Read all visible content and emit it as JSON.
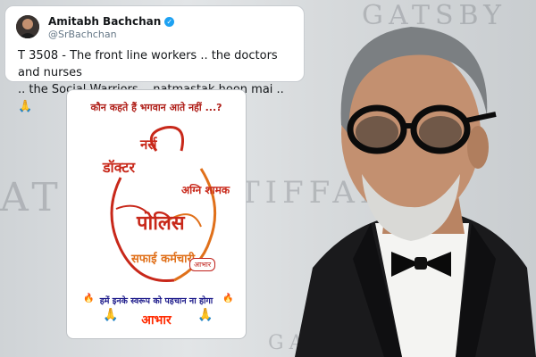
{
  "tweet": {
    "name": "Amitabh Bachchan",
    "handle": "@SrBachchan",
    "text_line1": "T 3508 - The front line workers .. the doctors and nurses",
    "text_line2": ".. the Social Warriors .. natmastak hoon mai  .. 🙏"
  },
  "poster": {
    "question": "कौन कहते हैं भगवान आते नहीं ...?",
    "calligraphy_words": [
      "नर्स",
      "डॉक्टर",
      "अग्नि शामक",
      "पोलिस",
      "सफाई कर्मचारी"
    ],
    "stamp": "आभार",
    "tagline": "हमें इनके स्वरूप को पहचान ना होगा",
    "thanks": "आभार"
  },
  "background": {
    "words": [
      "ATSBY",
      "TIFFANY",
      "GATSBY",
      "GALAXY"
    ]
  },
  "colors": {
    "calligraphy_red": "#c8281a",
    "calligraphy_orange": "#e0701a",
    "verified_blue": "#1da1f2"
  }
}
